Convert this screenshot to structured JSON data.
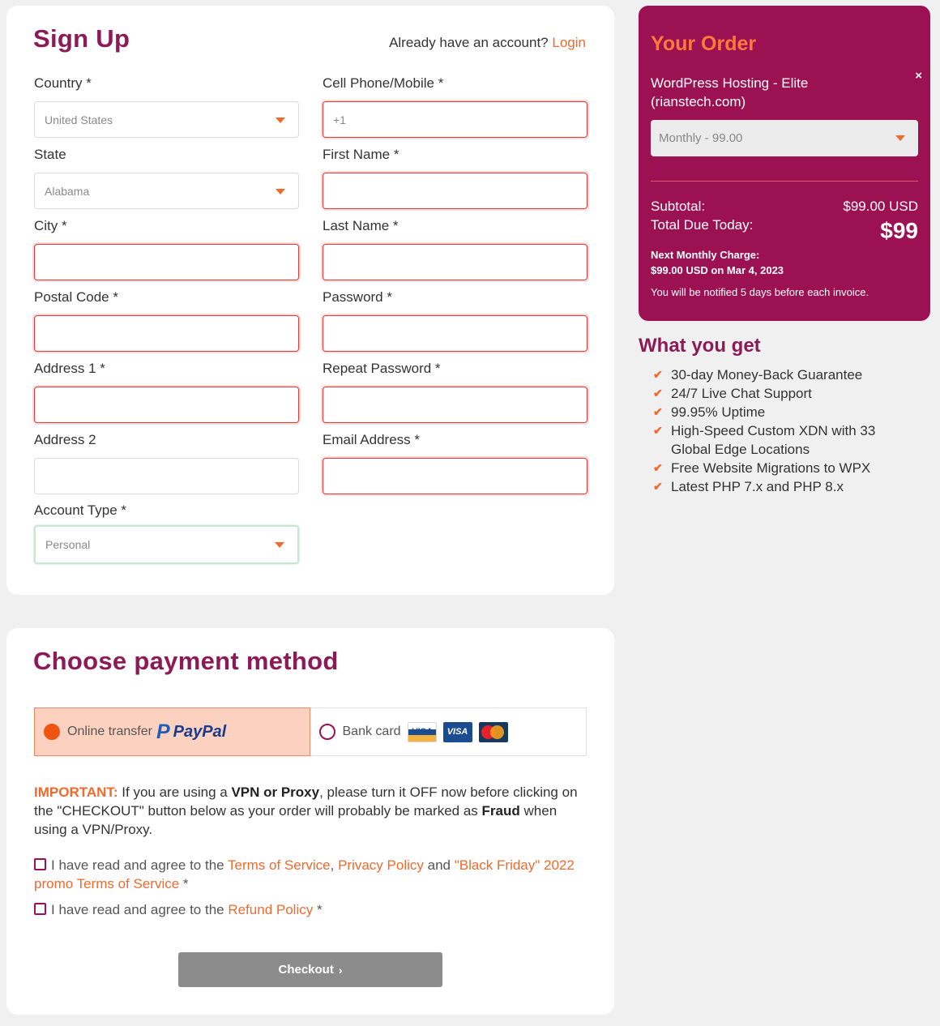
{
  "signup": {
    "title": "Sign Up",
    "already_text": "Already have an account?",
    "login_label": "Login",
    "fields": {
      "country": {
        "label": "Country *",
        "value": "United States"
      },
      "state": {
        "label": "State",
        "value": "Alabama"
      },
      "city": {
        "label": "City *",
        "value": ""
      },
      "postal": {
        "label": "Postal Code *",
        "value": ""
      },
      "address1": {
        "label": "Address 1 *",
        "value": ""
      },
      "address2": {
        "label": "Address 2",
        "value": ""
      },
      "account_type": {
        "label": "Account Type *",
        "value": "Personal"
      },
      "phone": {
        "label": "Cell Phone/Mobile *",
        "value": "+1"
      },
      "first_name": {
        "label": "First Name *",
        "value": ""
      },
      "last_name": {
        "label": "Last Name *",
        "value": ""
      },
      "password": {
        "label": "Password *",
        "value": ""
      },
      "repeat_password": {
        "label": "Repeat Password *",
        "value": ""
      },
      "email": {
        "label": "Email Address *",
        "value": ""
      }
    }
  },
  "order": {
    "title": "Your Order",
    "close": "×",
    "product_line1": "WordPress Hosting - Elite",
    "product_line2": "(rianstech.com)",
    "billing_cycle": "Monthly - 99.00",
    "subtotal_label": "Subtotal:",
    "subtotal_value": "$99.00 USD",
    "total_label": "Total Due Today:",
    "total_value": "$99",
    "next_charge_line1": "Next Monthly Charge:",
    "next_charge_line2": "$99.00 USD on Mar 4, 2023",
    "notify": "You will be notified 5 days before each invoice."
  },
  "what_you_get": {
    "title": "What you get",
    "items": [
      "30-day Money-Back Guarantee",
      "24/7 Live Chat Support",
      "99.95% Uptime",
      "High-Speed Custom XDN with 33 Global Edge Locations",
      "Free Website Migrations to WPX",
      "Latest PHP 7.x and PHP 8.x"
    ]
  },
  "payment": {
    "title": "Choose payment method",
    "online_label": "Online transfer",
    "paypal_label": "PayPal",
    "bank_label": "Bank card",
    "visa_label": "VISA",
    "mastercard_label": "MasterCard",
    "important_label": "IMPORTANT:",
    "important_text1": " If you are using a ",
    "important_bold1": "VPN or Proxy",
    "important_text2": ", please turn it OFF now before clicking on the \"CHECKOUT\" button below as your order will probably be marked as ",
    "important_bold2": "Fraud",
    "important_text3": " when using a VPN/Proxy.",
    "agree1_text": "I have read and agree to the ",
    "tos": "Terms of Service",
    "comma": ", ",
    "privacy": "Privacy Policy",
    "and": " and ",
    "promo": "\"Black Friday\" 2022 promo Terms of Service",
    "req": " *",
    "agree2_text": "I have read and agree to the ",
    "refund": "Refund Policy",
    "checkout_label": "Checkout",
    "checkout_arrow": "›"
  },
  "colors": {
    "brand": "#9b1152",
    "accent": "#f0692d",
    "heading": "#8b1a56"
  }
}
